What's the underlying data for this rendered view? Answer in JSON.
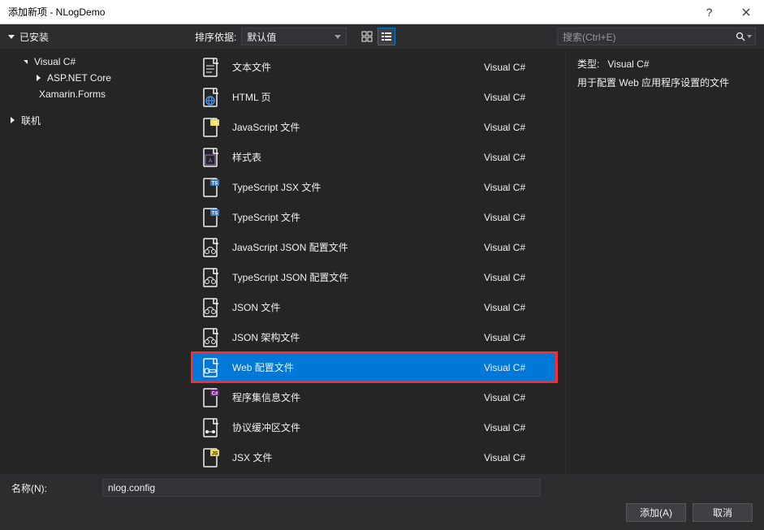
{
  "window": {
    "title": "添加新项 - NLogDemo"
  },
  "toolbar": {
    "installed_label": "已安装",
    "sort_label": "排序依据:",
    "sort_value": "默认值",
    "search_placeholder": "搜索(Ctrl+E)"
  },
  "sidebar": {
    "items": [
      {
        "label": "Visual C#",
        "level": 2,
        "chevron": "open"
      },
      {
        "label": "ASP.NET Core",
        "level": 3,
        "chevron": "closed"
      },
      {
        "label": "Xamarin.Forms",
        "level": 3,
        "chevron": "none"
      }
    ],
    "online_label": "联机"
  },
  "templates": [
    {
      "icon": "doc",
      "label": "文本文件",
      "lang": "Visual C#",
      "selected": false
    },
    {
      "icon": "html",
      "label": "HTML 页",
      "lang": "Visual C#",
      "selected": false
    },
    {
      "icon": "js",
      "label": "JavaScript 文件",
      "lang": "Visual C#",
      "selected": false
    },
    {
      "icon": "css",
      "label": "样式表",
      "lang": "Visual C#",
      "selected": false
    },
    {
      "icon": "tsx",
      "label": "TypeScript JSX 文件",
      "lang": "Visual C#",
      "selected": false
    },
    {
      "icon": "ts",
      "label": "TypeScript 文件",
      "lang": "Visual C#",
      "selected": false
    },
    {
      "icon": "json",
      "label": "JavaScript JSON 配置文件",
      "lang": "Visual C#",
      "selected": false
    },
    {
      "icon": "json",
      "label": "TypeScript JSON 配置文件",
      "lang": "Visual C#",
      "selected": false
    },
    {
      "icon": "json",
      "label": "JSON 文件",
      "lang": "Visual C#",
      "selected": false
    },
    {
      "icon": "json",
      "label": "JSON 架构文件",
      "lang": "Visual C#",
      "selected": false
    },
    {
      "icon": "config",
      "label": "Web 配置文件",
      "lang": "Visual C#",
      "selected": true
    },
    {
      "icon": "cs",
      "label": "程序集信息文件",
      "lang": "Visual C#",
      "selected": false
    },
    {
      "icon": "proto",
      "label": "协议缓冲区文件",
      "lang": "Visual C#",
      "selected": false
    },
    {
      "icon": "jsx",
      "label": "JSX 文件",
      "lang": "Visual C#",
      "selected": false
    }
  ],
  "info": {
    "type_label": "类型:",
    "type_value": "Visual C#",
    "description": "用于配置 Web 应用程序设置的文件"
  },
  "footer": {
    "name_label": "名称(N):",
    "name_value": "nlog.config",
    "add_label": "添加(A)",
    "cancel_label": "取消"
  }
}
